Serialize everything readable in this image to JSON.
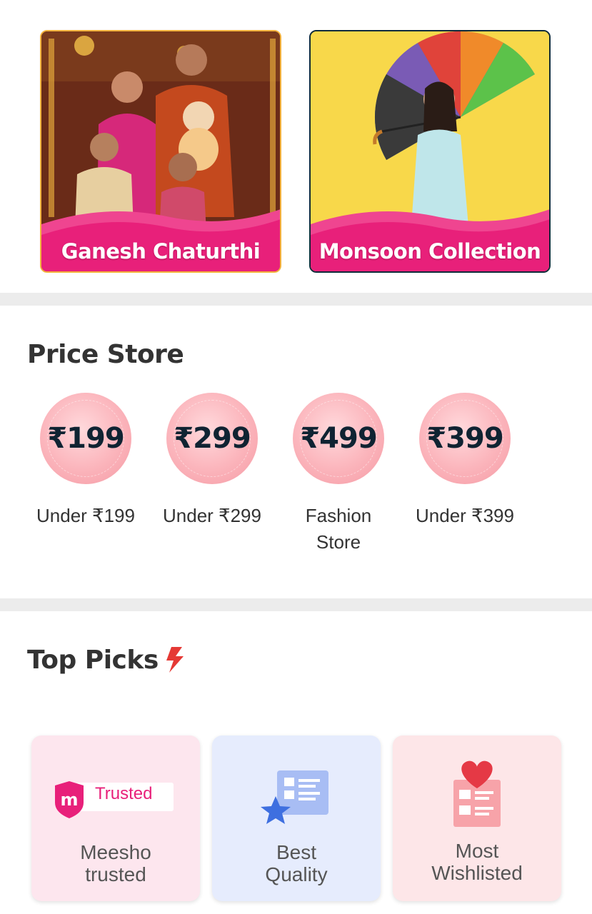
{
  "banners": [
    {
      "caption": "Ganesh Chaturthi"
    },
    {
      "caption": "Monsoon Collection"
    }
  ],
  "price_store": {
    "title": "Price Store",
    "items": [
      {
        "price": "₹199",
        "label": "Under ₹199"
      },
      {
        "price": "₹299",
        "label": "Under ₹299"
      },
      {
        "price": "₹499",
        "label": "Fashion\nStore"
      },
      {
        "price": "₹399",
        "label": "Under ₹399"
      }
    ]
  },
  "top_picks": {
    "title": "Top Picks",
    "badge_text": "Trusted",
    "items": [
      {
        "label": "Meesho\ntrusted",
        "icon": "meesho-trusted-icon",
        "bg": "#fde6ee"
      },
      {
        "label": "Best\nQuality",
        "icon": "best-quality-icon",
        "bg": "#e6ecfd"
      },
      {
        "label": "Most\nWishlisted",
        "icon": "wishlist-icon",
        "bg": "#fde6e8"
      }
    ]
  },
  "colors": {
    "brand_pink": "#e8207a",
    "accent_red": "#e53935",
    "text_dark": "#333333",
    "price_text": "#0f2332"
  }
}
